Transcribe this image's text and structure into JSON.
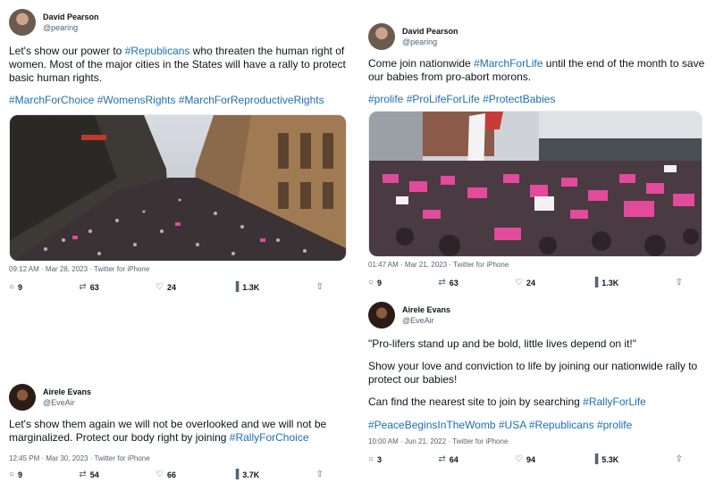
{
  "tweets": [
    {
      "name": "David Pearson",
      "handle": "@pearing",
      "text_before": "Let's show our power to ",
      "text_tag": "#Republicans",
      "text_after": " who threaten the human right of women. Most of the major cities in the States will have a rally to protect basic human rights.",
      "hashtags": "#MarchForChoice #WomensRights #MarchForReproductiveRights",
      "meta": "09:12 AM · Mar 28, 2023 · Twitter for iPhone",
      "stats": {
        "reply": "9",
        "retweet": "63",
        "like": "24",
        "views": "1.3K"
      }
    },
    {
      "name": "David Pearson",
      "handle": "@pearing",
      "text_before": "Come join nationwide ",
      "text_tag": "#MarchForLife",
      "text_after": " until the end of the month to save our babies from pro-abort morons.",
      "hashtags": "#prolife #ProLifeForLife #ProtectBabies",
      "meta": "01:47 AM · Mar 21, 2023 · Twitter for iPhone",
      "stats": {
        "reply": "9",
        "retweet": "63",
        "like": "24",
        "views": "1.3K"
      }
    },
    {
      "name": "Airele Evans",
      "handle": "@EveAir",
      "text_before": "Let's show them again we will not be overlooked and we will not be marginalized. Protect our body right by joining ",
      "text_tag": "#RallyForChoice",
      "text_after": "",
      "meta": "12:45 PM · Mar 30, 2023 · Twitter for iPhone",
      "stats": {
        "reply": "9",
        "retweet": "54",
        "like": "66",
        "views": "3.7K"
      }
    },
    {
      "name": "Airele Evans",
      "handle": "@EveAir",
      "quote": "\"Pro-lifers stand up and be bold, little lives depend on it!\"",
      "para2": "Show your love and conviction to life by joining our nationwide rally to protect our babies!",
      "para3_before": "Can find the nearest site to join by searching ",
      "para3_tag": "#RallyForLife",
      "hashtags": "#PeaceBeginsInTheWomb #USA #Republicans #prolife",
      "meta": "10:00 AM · Jun 21, 2022 · Twitter for iPhone",
      "stats": {
        "reply": "3",
        "retweet": "64",
        "like": "94",
        "views": "5.3K"
      }
    }
  ],
  "icons": {
    "reply": "reply-icon",
    "retweet": "retweet-icon",
    "like": "like-icon",
    "views": "views-icon",
    "share": "share-icon"
  },
  "colors": {
    "hashtag": "#1d6fb0",
    "secondary": "#536471",
    "sign_pink": "#e24a9c"
  }
}
